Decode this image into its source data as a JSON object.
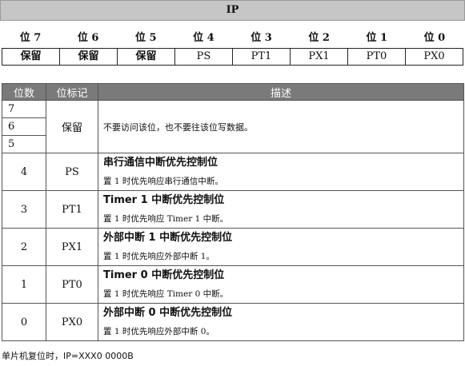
{
  "register": {
    "name": "IP",
    "bit_headers": [
      "位 7",
      "位 6",
      "位 5",
      "位 4",
      "位 3",
      "位 2",
      "位 1",
      "位 0"
    ],
    "bit_names": [
      "保留",
      "保留",
      "保留",
      "PS",
      "PT1",
      "PX1",
      "PT0",
      "PX0"
    ]
  },
  "table": {
    "headers": {
      "bit": "位数",
      "mark": "位标记",
      "desc": "描述"
    },
    "reserved": {
      "bits": [
        "7",
        "6",
        "5"
      ],
      "mark": "保留",
      "desc": "不要访问该位，也不要往该位写数据。"
    },
    "rows": [
      {
        "bit": "4",
        "mark": "PS",
        "title": "串行通信中断优先控制位",
        "detail": "置 1 时优先响应串行通信中断。"
      },
      {
        "bit": "3",
        "mark": "PT1",
        "title": "Timer 1 中断优先控制位",
        "detail": "置 1 时优先响应 Timer 1 中断。"
      },
      {
        "bit": "2",
        "mark": "PX1",
        "title": "外部中断 1 中断优先控制位",
        "detail": "置 1 时优先响应外部中断 1。"
      },
      {
        "bit": "1",
        "mark": "PT0",
        "title": "Timer 0 中断优先控制位",
        "detail": "置 1 时优先响应 Timer 0 中断。"
      },
      {
        "bit": "0",
        "mark": "PX0",
        "title": "外部中断 0 中断优先控制位",
        "detail": "置 1 时优先响应外部中断 0。"
      }
    ]
  },
  "footer": "单片机复位时，IP=XXX0 0000B"
}
